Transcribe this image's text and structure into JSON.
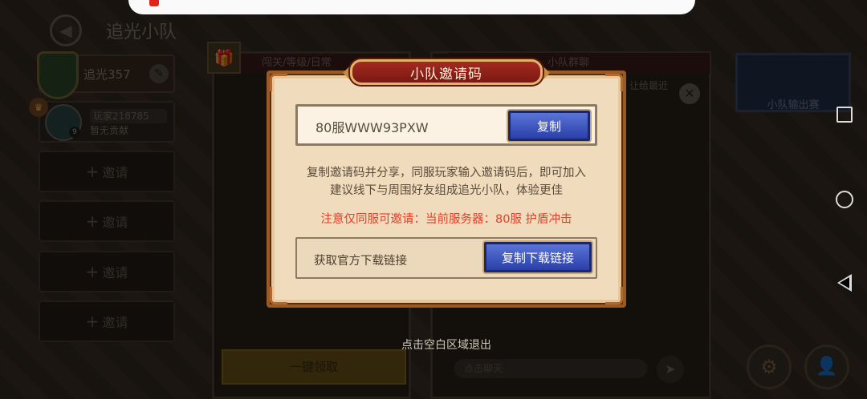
{
  "header": {
    "title": "追光小队",
    "back_icon": "back-arrow-icon"
  },
  "team": {
    "name": "追光357",
    "icon": "leaf-shield-icon"
  },
  "members": [
    {
      "name": "玩家218785",
      "subtitle": "暂无贡献",
      "level": "9"
    }
  ],
  "invite_slots": [
    "邀请",
    "邀请",
    "邀请",
    "邀请"
  ],
  "center_panel": {
    "tab_label": "闯关/等级/日常",
    "claim_button": "一键领取"
  },
  "chat": {
    "tab_label": "小队群聊",
    "notice": "让给最近",
    "input_placeholder": "点击聊天"
  },
  "boss": {
    "label": "小队输出赛"
  },
  "modal": {
    "title": "小队邀请码",
    "invite_code": "80服WWW93PXW",
    "copy_button": "复制",
    "description_line1": "复制邀请码并分享，同服玩家输入邀请码后，即可加入",
    "description_line2": "建议线下与周围好友组成追光小队，体验更佳",
    "warning": "注意仅同服可邀请：当前服务器：80服  护盾冲击",
    "download_label": "获取官方下载链接",
    "download_button": "复制下载链接"
  },
  "exit_hint": "点击空白区域退出",
  "colors": {
    "modal_bg": "#f0dcbc",
    "title_bar": "#a42a20",
    "button_blue": "#2a40a8",
    "warning": "#e2402a"
  }
}
